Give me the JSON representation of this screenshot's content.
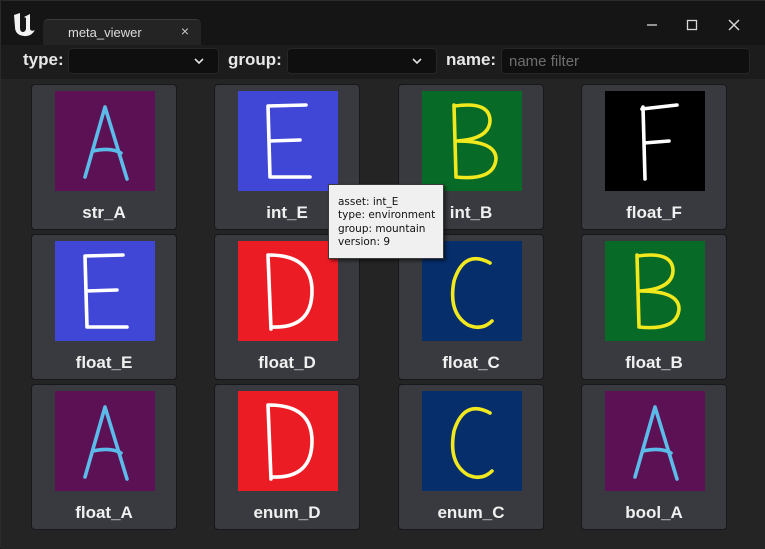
{
  "window": {
    "tab_title": "meta_viewer",
    "tab_close": "×"
  },
  "toolbar": {
    "type_label": "type:",
    "type_value": "",
    "group_label": "group:",
    "group_value": "",
    "name_label": "name:",
    "name_value": "",
    "name_placeholder": "name filter"
  },
  "assets": [
    {
      "label": "str_A",
      "letter": "A",
      "bg": "#5c1155",
      "fg": "#5bbcea"
    },
    {
      "label": "int_E",
      "letter": "E",
      "bg": "#4046d6",
      "fg": "#ffffff"
    },
    {
      "label": "int_B",
      "letter": "B",
      "bg": "#076a27",
      "fg": "#f2e81e"
    },
    {
      "label": "float_F",
      "letter": "F",
      "bg": "#000000",
      "fg": "#ffffff"
    },
    {
      "label": "float_E",
      "letter": "E",
      "bg": "#4046d6",
      "fg": "#ffffff"
    },
    {
      "label": "float_D",
      "letter": "D",
      "bg": "#ec1c24",
      "fg": "#ffffff"
    },
    {
      "label": "float_C",
      "letter": "C",
      "bg": "#062e6b",
      "fg": "#f2e81e"
    },
    {
      "label": "float_B",
      "letter": "B",
      "bg": "#076a27",
      "fg": "#f2e81e"
    },
    {
      "label": "float_A",
      "letter": "A",
      "bg": "#5c1155",
      "fg": "#5bbcea"
    },
    {
      "label": "enum_D",
      "letter": "D",
      "bg": "#ec1c24",
      "fg": "#ffffff"
    },
    {
      "label": "enum_C",
      "letter": "C",
      "bg": "#062e6b",
      "fg": "#f2e81e"
    },
    {
      "label": "bool_A",
      "letter": "A",
      "bg": "#5c1155",
      "fg": "#5bbcea"
    }
  ],
  "tooltip": {
    "asset": "asset: int_E",
    "type": "type: environment",
    "group": "group: mountain",
    "version": "version: 9"
  }
}
